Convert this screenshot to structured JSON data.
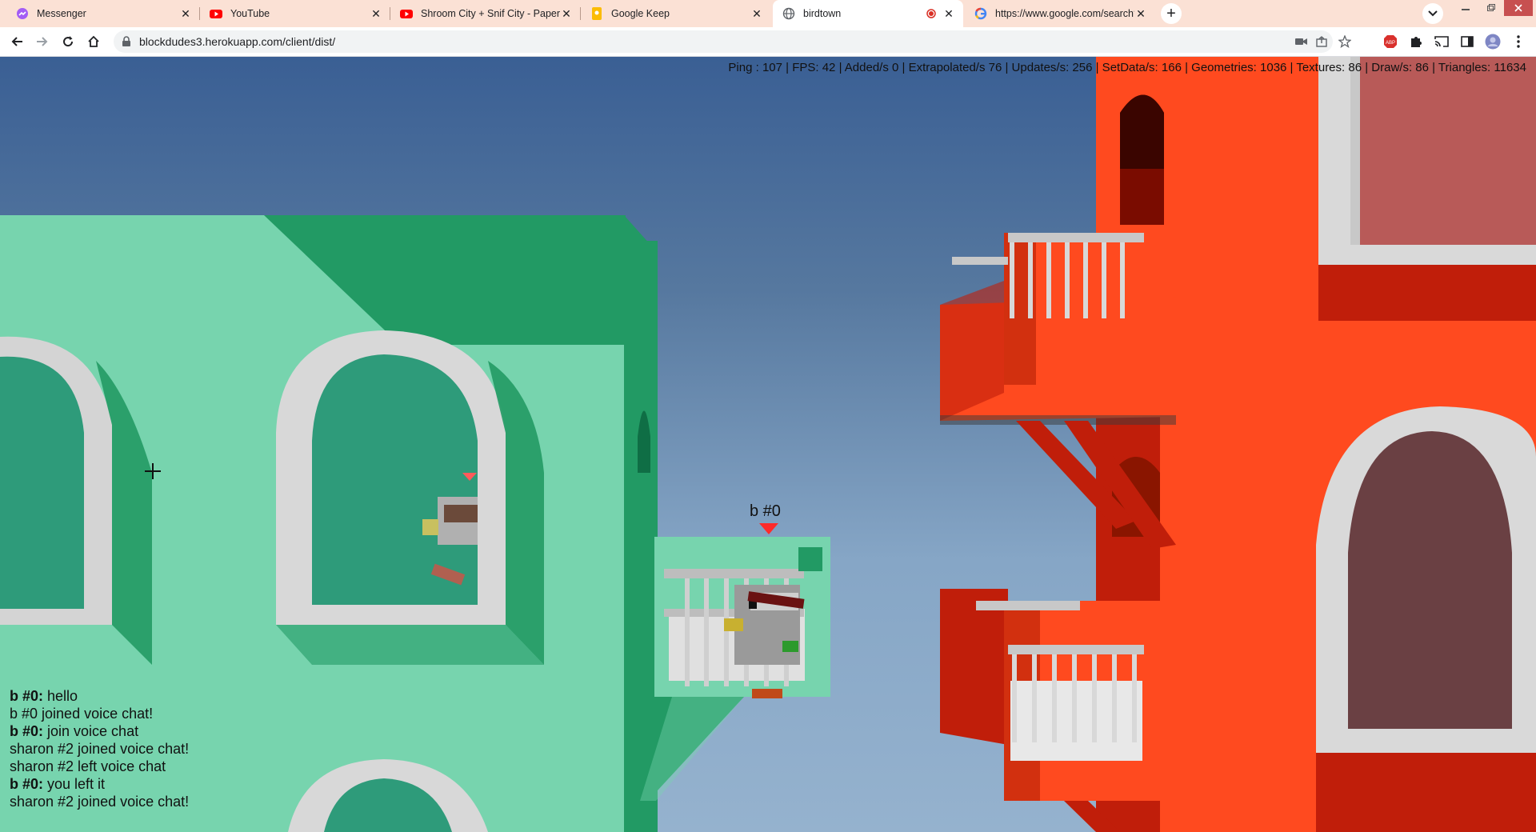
{
  "browser": {
    "tabs": [
      {
        "title": "Messenger",
        "icon": "messenger-icon"
      },
      {
        "title": "YouTube",
        "icon": "youtube-icon"
      },
      {
        "title": "Shroom City + Snif City - Paper M",
        "icon": "youtube-icon"
      },
      {
        "title": "Google Keep",
        "icon": "google-keep-icon"
      },
      {
        "title": "birdtown",
        "icon": "globe-icon",
        "active": true
      },
      {
        "title": "https://www.google.com/search?",
        "icon": "google-icon"
      }
    ],
    "address": "blockdudes3.herokuapp.com/client/dist/"
  },
  "game": {
    "stats": "Ping : 107 | FPS: 42 | Added/s 0 | Extrapolated/s 76 | Updates/s: 256 | SetData/s: 166 | Geometries: 1036 | Textures: 86 | Draw/s: 86 | Triangles: 11634",
    "player_label": "b #0",
    "chat": [
      {
        "name": "b #0:",
        "text": " hello"
      },
      {
        "name": "",
        "text": "b #0 joined voice chat!"
      },
      {
        "name": "b #0:",
        "text": " join voice chat"
      },
      {
        "name": "",
        "text": "sharon #2 joined voice chat!"
      },
      {
        "name": "",
        "text": "sharon #2 left voice chat"
      },
      {
        "name": "b #0:",
        "text": " you left it"
      },
      {
        "name": "",
        "text": "sharon #2 joined voice chat!"
      }
    ]
  },
  "colors": {
    "sky_top": "#3a5f94",
    "green_building": "#77d4ae",
    "green_shadow": "#229a64",
    "orange_building": "#ff4a1f",
    "orange_shadow": "#c01e0a",
    "window_frame": "#d9d9d9",
    "marker_red": "#ff2a2a"
  }
}
